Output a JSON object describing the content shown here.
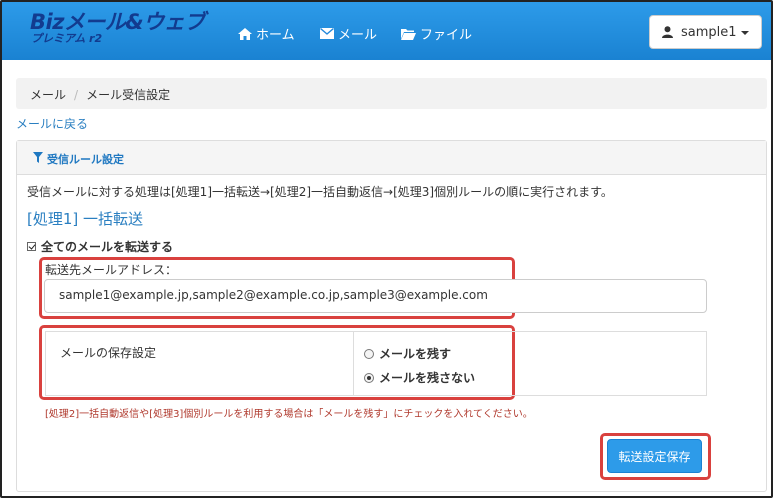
{
  "header": {
    "logo_main": "Bizメール&ウェブ",
    "logo_sub": "プレミアム r2",
    "nav": [
      {
        "label": "ホーム",
        "icon": "home-icon"
      },
      {
        "label": "メール",
        "icon": "envelope-icon"
      },
      {
        "label": "ファイル",
        "icon": "folder-icon"
      }
    ],
    "user": {
      "name": "sample1",
      "icon": "user-icon"
    }
  },
  "breadcrumb": {
    "items": [
      "メール",
      "メール受信設定"
    ],
    "separator": "/"
  },
  "back_link": "メールに戻る",
  "panel": {
    "title": "受信ルール設定",
    "title_icon": "filter-icon",
    "description": "受信メールに対する処理は[処理1]一括転送→[処理2]一括自動返信→[処理3]個別ルールの順に実行されます。",
    "section_title": "[処理1] 一括転送",
    "forward_all": {
      "label": "全てのメールを転送する",
      "checked": true
    },
    "address_label": "転送先メールアドレス：",
    "address_value": "sample1@example.jp,sample2@example.co.jp,sample3@example.com",
    "save_setting": {
      "label": "メールの保存設定",
      "options": [
        {
          "label": "メールを残す",
          "selected": false
        },
        {
          "label": "メールを残さない",
          "selected": true
        }
      ]
    },
    "warning": "[処理2]一括自動返信や[処理3]個別ルールを利用する場合は「メールを残す」にチェックを入れてください。",
    "submit_label": "転送設定保存"
  },
  "colors": {
    "navbar": "#2d9be9",
    "accent": "#2a7fc1",
    "highlight": "#d9413e",
    "warning": "#b03a2e"
  }
}
